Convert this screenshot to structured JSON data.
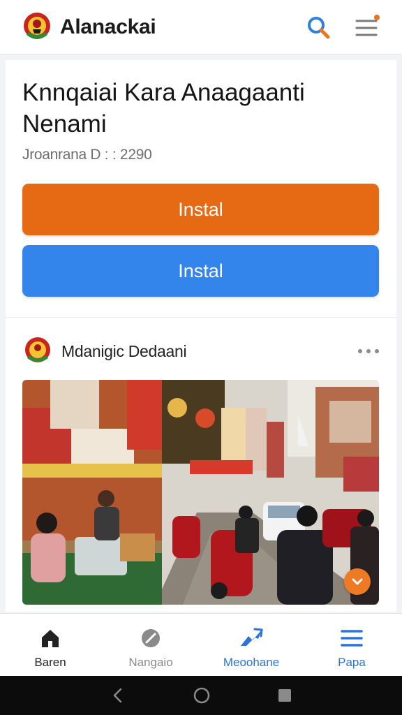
{
  "app": {
    "title": "Alanackai"
  },
  "article": {
    "title": "Knnqaiai Kara Anaagaanti Nenami",
    "meta": "Jroanrana D : : 2290",
    "primary_button": "Instal",
    "secondary_button": "Instal"
  },
  "post": {
    "author": "Mdanigic Dedaani"
  },
  "nav": {
    "items": [
      {
        "label": "Baren",
        "icon": "home-icon",
        "color": "#222222"
      },
      {
        "label": "Nangaio",
        "icon": "leaf-icon",
        "color": "#8a8a8a"
      },
      {
        "label": "Meoohane",
        "icon": "star-icon",
        "color": "#2b73d6"
      },
      {
        "label": "Papa",
        "icon": "menu-icon",
        "color": "#2b73d6"
      }
    ]
  },
  "colors": {
    "orange": "#e66914",
    "blue": "#3385ec",
    "accent": "#2b73d6"
  }
}
